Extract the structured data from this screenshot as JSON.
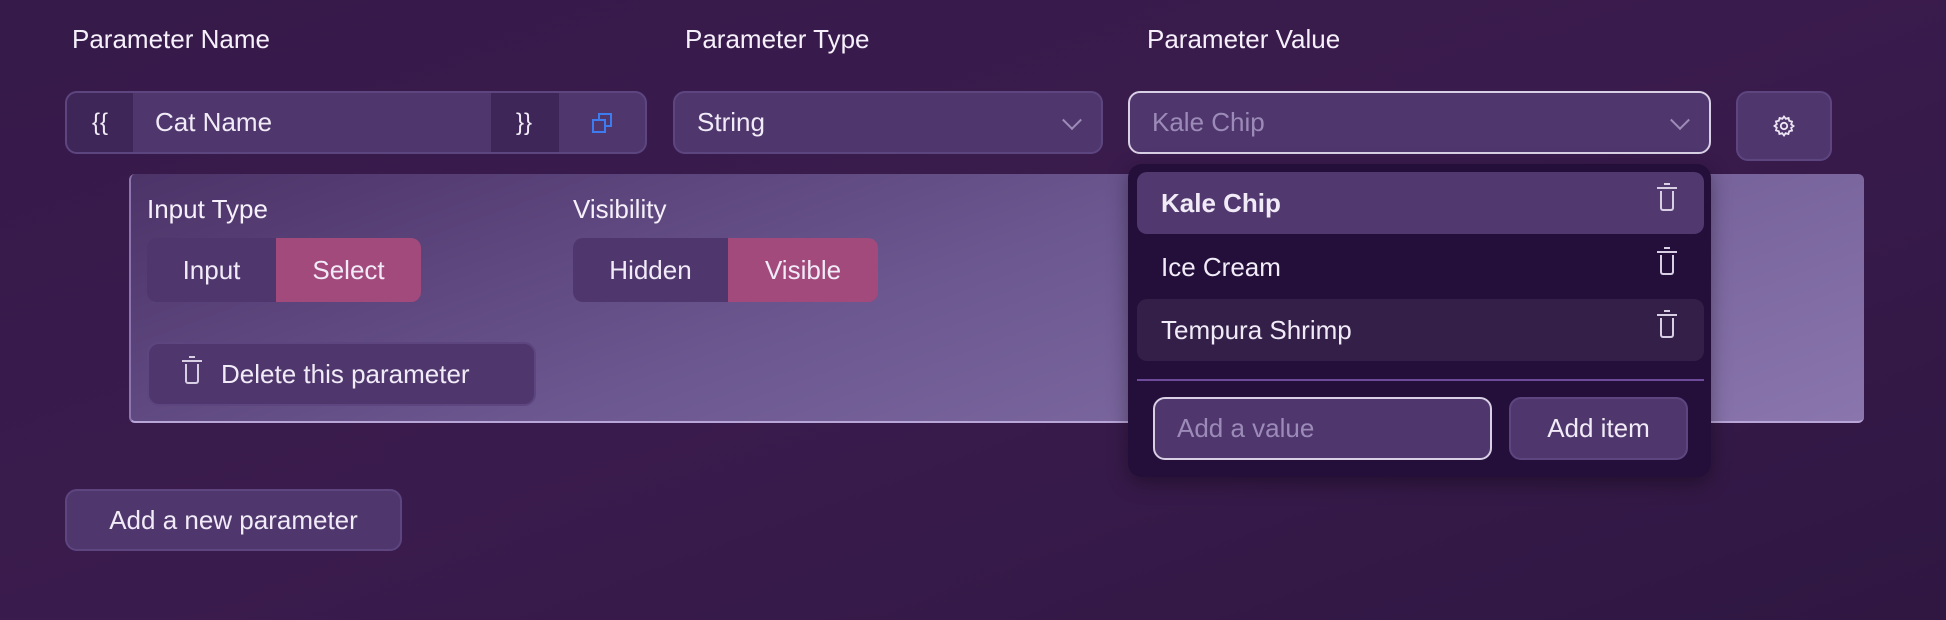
{
  "headers": {
    "name": "Parameter Name",
    "type": "Parameter Type",
    "value": "Parameter Value"
  },
  "name_field": {
    "open_brace": "{{",
    "value": "Cat Name",
    "close_brace": "}}",
    "copy_icon": "copy-icon"
  },
  "type_select": {
    "value": "String"
  },
  "value_select": {
    "value": "Kale Chip",
    "settings_icon": "gear-icon"
  },
  "panel": {
    "input_type": {
      "label": "Input Type",
      "options": [
        "Input",
        "Select"
      ],
      "selected": "Select"
    },
    "visibility": {
      "label": "Visibility",
      "options": [
        "Hidden",
        "Visible"
      ],
      "selected": "Visible"
    },
    "delete_label": "Delete this parameter"
  },
  "dropdown": {
    "items": [
      "Kale Chip",
      "Ice Cream",
      "Tempura Shrimp"
    ],
    "selected": "Kale Chip",
    "add_placeholder": "Add a value",
    "add_button": "Add item"
  },
  "add_parameter": "Add a new parameter",
  "colors": {
    "accent": "#a34a7c",
    "copy": "#3d7bf0"
  }
}
